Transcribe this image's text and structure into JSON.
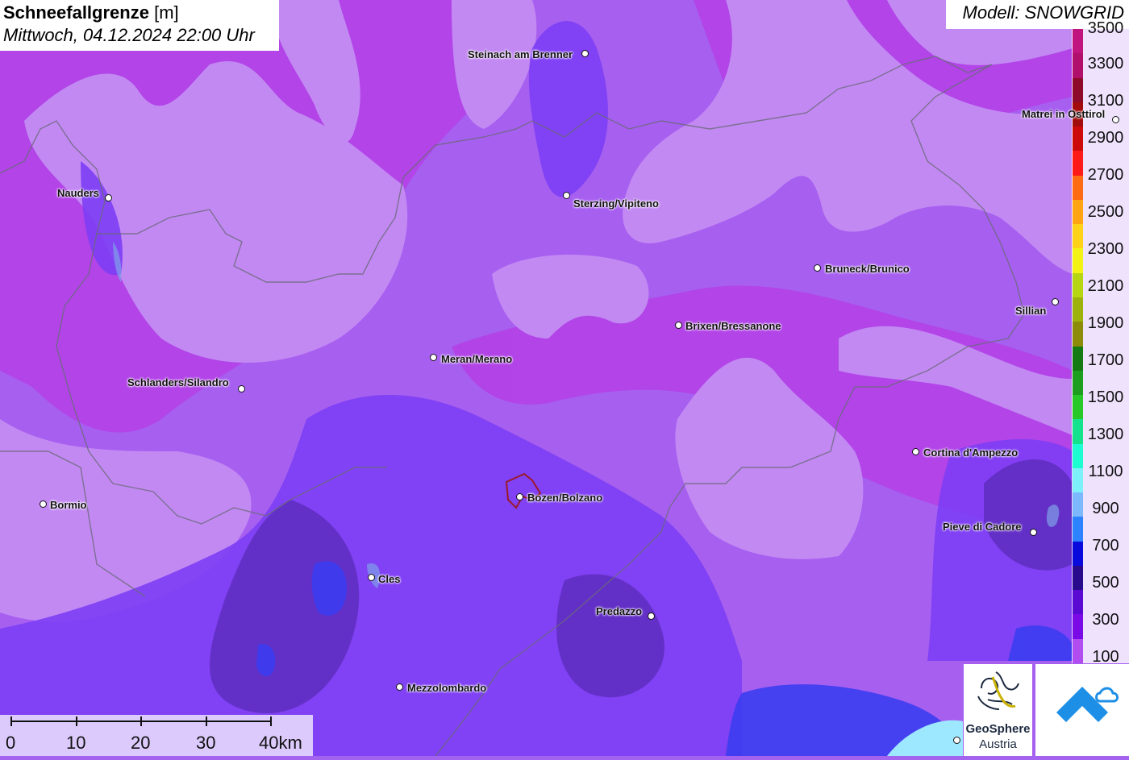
{
  "header": {
    "title_bold": "Schneefallgrenze",
    "title_unit": "[m]",
    "subtitle": "Mittwoch, 04.12.2024 22:00 Uhr",
    "model": "Modell: SNOWGRID"
  },
  "legend": {
    "labels": [
      "3500",
      "3300",
      "3100",
      "2900",
      "2700",
      "2500",
      "2300",
      "2100",
      "1900",
      "1700",
      "1500",
      "1300",
      "1100",
      "900",
      "700",
      "500",
      "300",
      "100"
    ],
    "colors": [
      "#c0147e",
      "#b0106c",
      "#8e0a2a",
      "#a30c0c",
      "#cc0a0a",
      "#ff1a1a",
      "#ff6a14",
      "#ffa514",
      "#ffd21a",
      "#f2f216",
      "#b6d614",
      "#9eb20e",
      "#8c8c0a",
      "#137a14",
      "#1e9e1e",
      "#28c828",
      "#14e28c",
      "#1efcd2",
      "#7ef0fa",
      "#7cb8ff",
      "#2d82ff",
      "#0a0adc",
      "#2a0a8c",
      "#5a0ad2",
      "#7a0ae6",
      "#b04cf0"
    ]
  },
  "cities": [
    {
      "name": "Steinach am Brenner"
    },
    {
      "name": "Matrei in Osttirol"
    },
    {
      "name": "Nauders"
    },
    {
      "name": "Sterzing/Vipiteno"
    },
    {
      "name": "Bruneck/Brunico"
    },
    {
      "name": "Sillian"
    },
    {
      "name": "Brixen/Bressanone"
    },
    {
      "name": "Meran/Merano"
    },
    {
      "name": "Schlanders/Silandro"
    },
    {
      "name": "Cortina d'Ampezzo"
    },
    {
      "name": "Bormio"
    },
    {
      "name": "Bozen/Bolzano"
    },
    {
      "name": "Pieve di Cadore"
    },
    {
      "name": "Cles"
    },
    {
      "name": "Predazzo"
    },
    {
      "name": "Mezzolombardo"
    }
  ],
  "scale": {
    "labels": [
      "0",
      "10",
      "20",
      "30",
      "40km"
    ]
  },
  "logos": {
    "geosphere_line1": "GeoSphere",
    "geosphere_line2": "Austria"
  },
  "colors": {
    "light_violet": "#c486f2",
    "violet": "#a45cf0",
    "magenta": "#b23ee6",
    "blue_violet": "#7a3cf2",
    "deep": "#5a2bc0"
  }
}
